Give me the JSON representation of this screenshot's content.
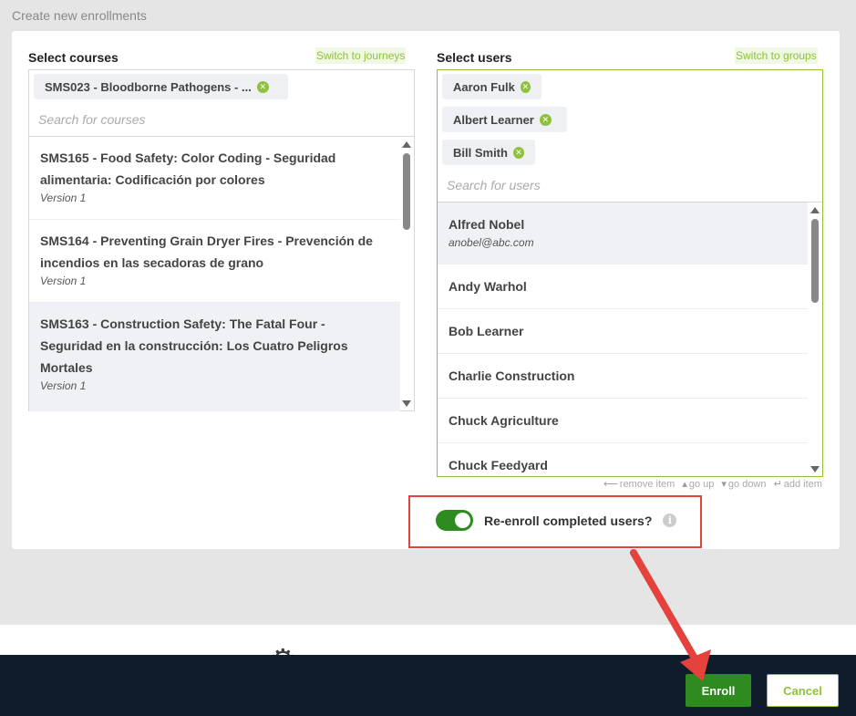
{
  "page": {
    "title": "Create new enrollments"
  },
  "courses": {
    "label": "Select courses",
    "switch_link": "Switch to journeys",
    "selected": [
      "SMS023 - Bloodborne Pathogens - ..."
    ],
    "search_placeholder": "Search for courses",
    "items": [
      {
        "title": "SMS165 - Food Safety: Color Coding - Seguridad alimentaria: Codificación por colores",
        "version": "Version 1"
      },
      {
        "title": "SMS164 - Preventing Grain Dryer Fires - Prevención de incendios en las secadoras de grano",
        "version": "Version 1"
      },
      {
        "title": "SMS163 - Construction Safety: The Fatal Four - Seguridad en la construcción: Los Cuatro Peligros Mortales",
        "version": "Version 1"
      }
    ]
  },
  "users": {
    "label": "Select users",
    "switch_link": "Switch to groups",
    "selected": [
      "Aaron Fulk",
      "Albert Learner",
      "Bill Smith"
    ],
    "search_placeholder": "Search for users",
    "items": [
      {
        "name": "Alfred Nobel",
        "email": "anobel@abc.com"
      },
      {
        "name": "Andy Warhol"
      },
      {
        "name": "Bob Learner"
      },
      {
        "name": "Charlie Construction"
      },
      {
        "name": "Chuck Agriculture"
      },
      {
        "name": "Chuck Feedyard"
      }
    ]
  },
  "hints": {
    "remove": "remove item",
    "up": "go up",
    "down": "go down",
    "add": "add item"
  },
  "reenroll": {
    "label": "Re-enroll completed users?",
    "enabled": true
  },
  "footer": {
    "enroll_label": "Enroll",
    "cancel_label": "Cancel"
  },
  "colors": {
    "accent": "#8fc23b",
    "primary": "#2e8b1f",
    "footer_bg": "#0f1c2b",
    "annotation": "#e5413d"
  }
}
